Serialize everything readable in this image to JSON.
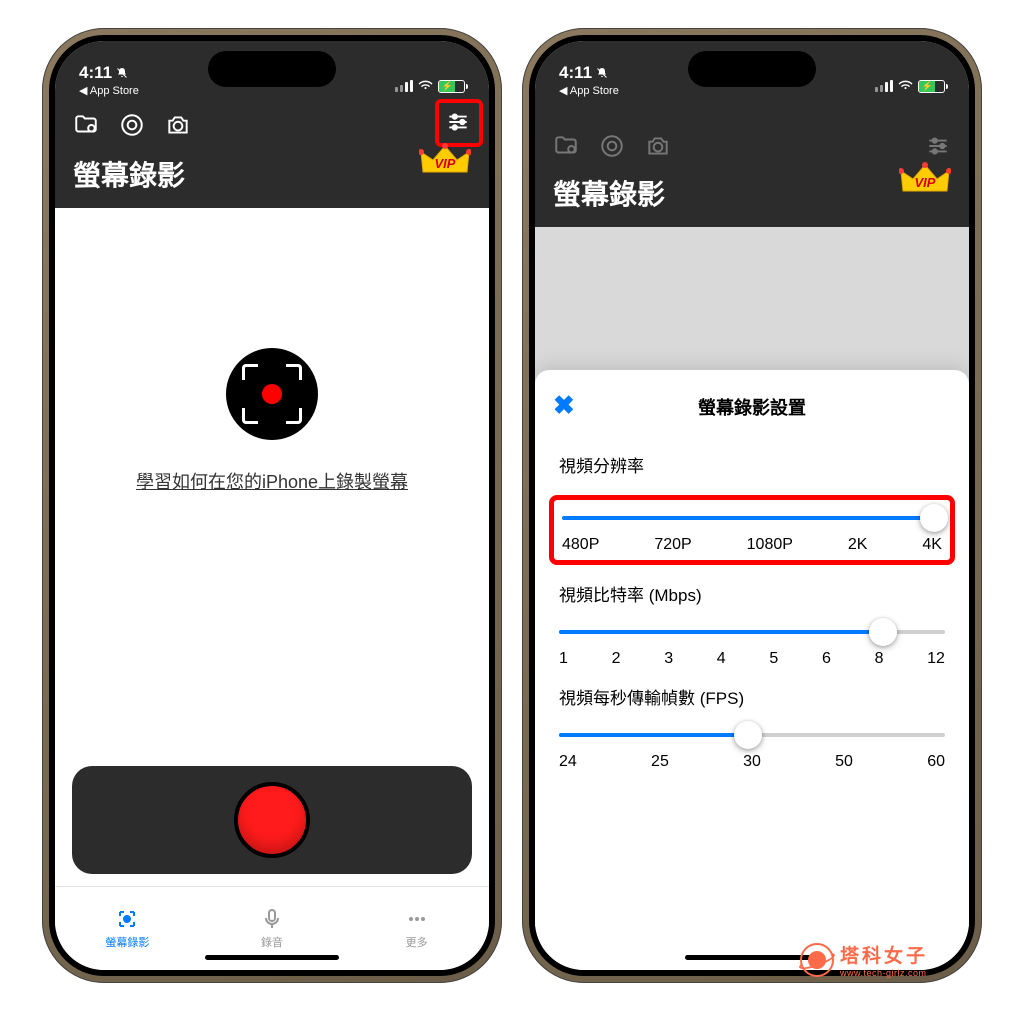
{
  "status": {
    "time": "4:11",
    "back_label": "App Store"
  },
  "header": {
    "title": "螢幕錄影",
    "vip_label": "VIP"
  },
  "main": {
    "learn_link": "學習如何在您的iPhone上錄製螢幕"
  },
  "tabs": {
    "record": "螢幕錄影",
    "audio": "錄音",
    "more": "更多"
  },
  "settings_sheet": {
    "title": "螢幕錄影設置",
    "close_glyph": "✖",
    "resolution": {
      "label": "視頻分辨率",
      "options": [
        "480P",
        "720P",
        "1080P",
        "2K",
        "4K"
      ],
      "selected_index": 4
    },
    "bitrate": {
      "label": "視頻比特率 (Mbps)",
      "options": [
        "1",
        "2",
        "3",
        "4",
        "5",
        "6",
        "8",
        "12"
      ],
      "selected_index": 6
    },
    "fps": {
      "label": "視頻每秒傳輸幀數 (FPS)",
      "options": [
        "24",
        "25",
        "30",
        "50",
        "60"
      ],
      "selected_index": 2
    }
  },
  "watermark": {
    "zh": "塔科女子",
    "en": "www.tech-girlz.com"
  }
}
